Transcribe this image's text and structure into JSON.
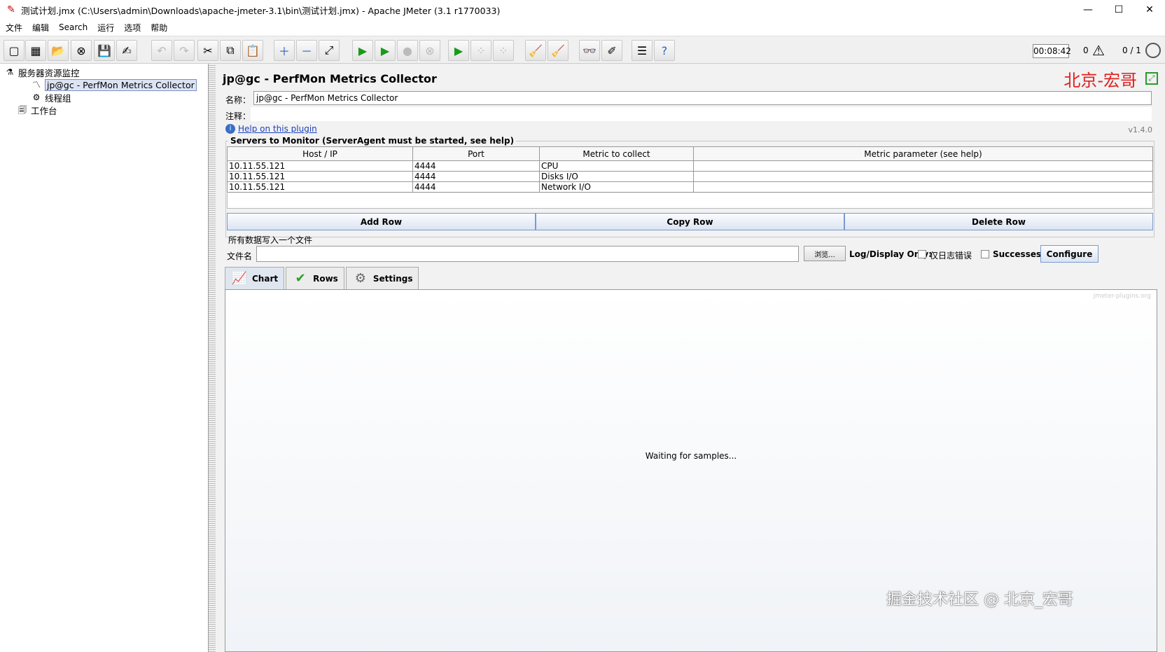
{
  "window": {
    "title": "测试计划.jmx (C:\\Users\\admin\\Downloads\\apache-jmeter-3.1\\bin\\测试计划.jmx) - Apache JMeter (3.1 r1770033)",
    "minimize": "—",
    "maximize": "☐",
    "close": "✕"
  },
  "menu": [
    "文件",
    "编辑",
    "Search",
    "运行",
    "选项",
    "帮助"
  ],
  "status": {
    "timer": "00:08:42",
    "errors": "0",
    "threads": "0 / 1"
  },
  "tree": {
    "root": "服务器资源监控",
    "selected": "jp@gc - PerfMon Metrics Collector",
    "thread_group": "线程组",
    "workbench": "工作台"
  },
  "panel": {
    "title": "jp@gc - PerfMon Metrics Collector",
    "watermark": "北京-宏哥",
    "name_label": "名称：",
    "name_value": "jp@gc - PerfMon Metrics Collector",
    "comment_label": "注释：",
    "help_link": "Help on this plugin",
    "version": "v1.4.0"
  },
  "servers": {
    "legend": "Servers to Monitor (ServerAgent must be started, see help)",
    "columns": [
      "Host / IP",
      "Port",
      "Metric to collect",
      "Metric parameter (see help)"
    ],
    "rows": [
      [
        "10.11.55.121",
        "4444",
        "CPU",
        ""
      ],
      [
        "10.11.55.121",
        "4444",
        "Disks I/O",
        ""
      ],
      [
        "10.11.55.121",
        "4444",
        "Network I/O",
        ""
      ]
    ],
    "add_row": "Add Row",
    "copy_row": "Copy Row",
    "delete_row": "Delete Row"
  },
  "file": {
    "legend": "所有数据写入一个文件",
    "label": "文件名",
    "value": "",
    "browse": "浏览...",
    "log_display_only": "Log/Display Only:",
    "errors_only": "仅日志错误",
    "successes": "Successes",
    "configure": "Configure"
  },
  "tabs": [
    "Chart",
    "Rows",
    "Settings"
  ],
  "chart": {
    "credit": "jmeter-plugins.org",
    "waiting": "Waiting for samples..."
  },
  "footer_watermark": "掘金技术社区 @ 北京_宏哥"
}
